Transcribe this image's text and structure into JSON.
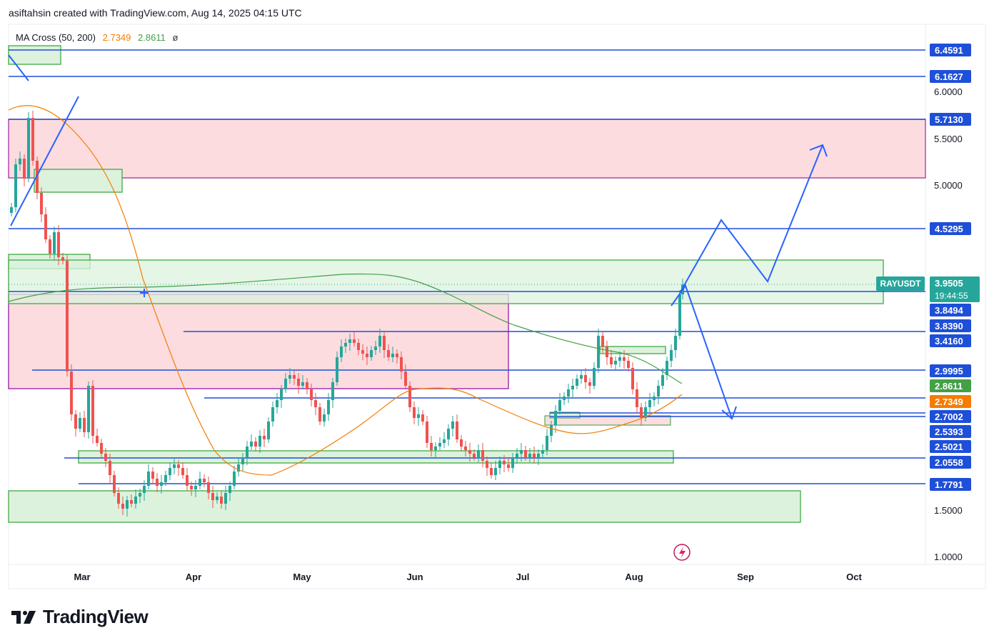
{
  "header": {
    "credit": "asiftahsin created with TradingView.com, Aug 14, 2025 04:15 UTC"
  },
  "legend": {
    "indicator": "MA Cross (50, 200)",
    "ma_fast_value": "2.7349",
    "ma_slow_value": "2.8611",
    "symbol": "ø"
  },
  "brand": {
    "name": "TradingView"
  },
  "colors": {
    "up": "#26a69a",
    "down": "#ef5350",
    "level_line": "#1e4fd8",
    "resistance_fill": "#fcdcdf",
    "support_fill": "#dcf2dd",
    "ma_fast": "#f57c00",
    "ma_slow": "#43a047",
    "projection": "#2962ff"
  },
  "chart_data": {
    "type": "candlestick",
    "symbol": "RAYUSDT",
    "scale": "log",
    "current_price": "3.9505",
    "countdown": "19:44:55",
    "x_ticks": [
      "Mar",
      "Apr",
      "May",
      "Jun",
      "Jul",
      "Aug",
      "Sep",
      "Oct"
    ],
    "y_ticks": [
      "6.0000",
      "5.5000",
      "5.0000",
      "1.5000",
      "1.0000"
    ],
    "price_levels": [
      {
        "label": "6.4591",
        "color": "#1e4fd8"
      },
      {
        "label": "6.1627",
        "color": "#1e4fd8"
      },
      {
        "label": "5.7130",
        "color": "#1e4fd8"
      },
      {
        "label": "4.5295",
        "color": "#1e4fd8"
      },
      {
        "label": "3.8494",
        "color": "#1e4fd8"
      },
      {
        "label": "3.8390",
        "color": "#1e4fd8"
      },
      {
        "label": "3.4160",
        "color": "#1e4fd8"
      },
      {
        "label": "2.9995",
        "color": "#1e4fd8"
      },
      {
        "label": "2.8611",
        "color": "#43a047"
      },
      {
        "label": "2.7349",
        "color": "#f57c00"
      },
      {
        "label": "2.7002",
        "color": "#1e4fd8"
      },
      {
        "label": "2.5393",
        "color": "#1e4fd8"
      },
      {
        "label": "2.5021",
        "color": "#1e4fd8"
      },
      {
        "label": "2.0558",
        "color": "#1e4fd8"
      },
      {
        "label": "1.7791",
        "color": "#1e4fd8"
      }
    ],
    "series": [
      {
        "name": "MA 50",
        "color": "#f57c00",
        "last": "2.7349"
      },
      {
        "name": "MA 200",
        "color": "#43a047",
        "last": "2.8611"
      }
    ]
  }
}
